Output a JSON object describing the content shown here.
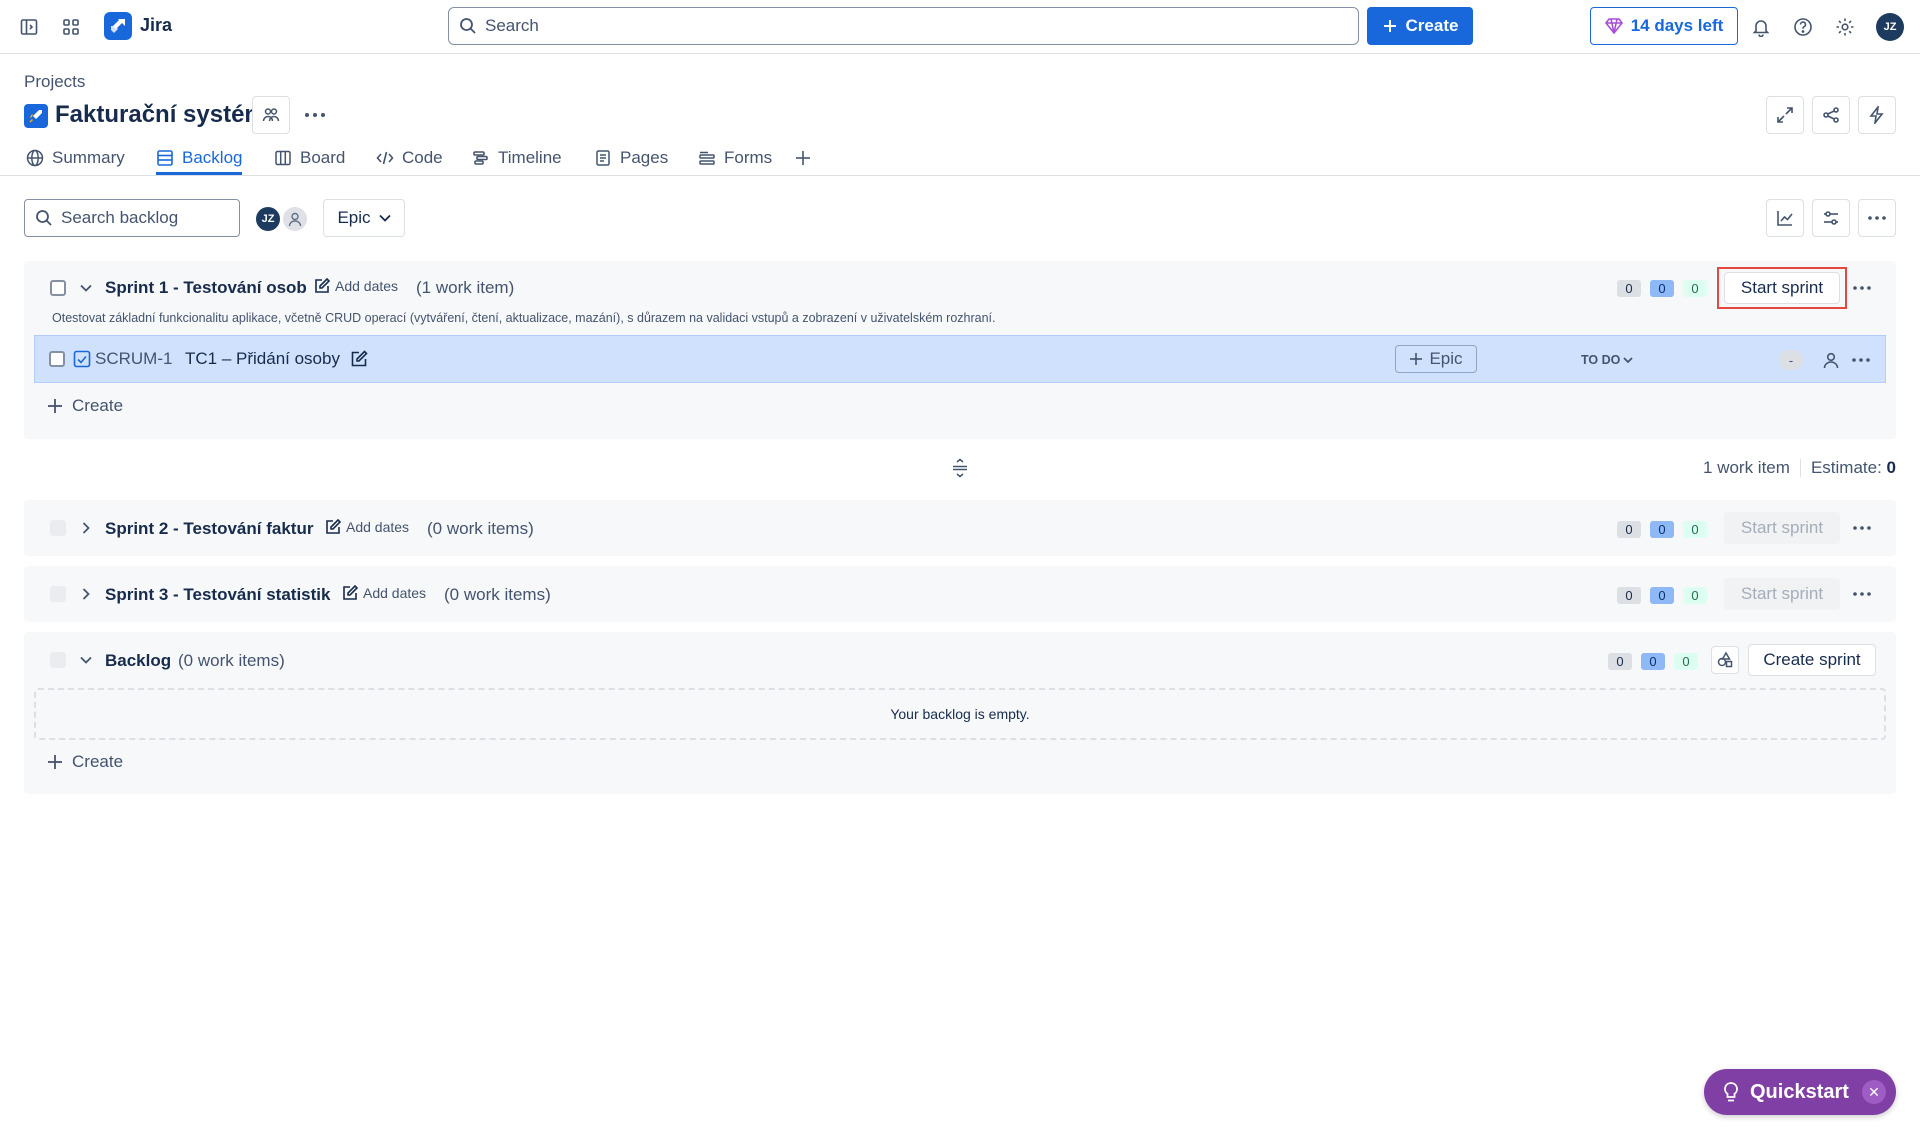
{
  "topbar": {
    "app_name": "Jira",
    "search_placeholder": "Search",
    "create_label": "Create",
    "trial_label": "14 days left",
    "avatar_initials": "JZ"
  },
  "project": {
    "breadcrumb": "Projects",
    "title": "Fakturační systém"
  },
  "tabs": [
    {
      "label": "Summary",
      "icon": "globe-icon"
    },
    {
      "label": "Backlog",
      "icon": "backlog-icon",
      "active": true
    },
    {
      "label": "Board",
      "icon": "board-icon"
    },
    {
      "label": "Code",
      "icon": "code-icon"
    },
    {
      "label": "Timeline",
      "icon": "timeline-icon"
    },
    {
      "label": "Pages",
      "icon": "pages-icon"
    },
    {
      "label": "Forms",
      "icon": "forms-icon"
    }
  ],
  "toolbar": {
    "search_placeholder": "Search backlog",
    "avatar_initials": "JZ",
    "epic_filter_label": "Epic"
  },
  "sprints": [
    {
      "name": "Sprint 1 - Testování osob",
      "add_dates": "Add dates",
      "count": "(1 work item)",
      "todo": "0",
      "in_progress": "0",
      "done": "0",
      "action": "Start sprint",
      "description": "Otestovat základní funkcionalitu aplikace, včetně CRUD operací (vytváření, čtení, aktualizace, mazání), s důrazem na validaci vstupů a zobrazení v uživatelském rozhraní.",
      "issue": {
        "key": "SCRUM-1",
        "title": "TC1 – Přidání osoby",
        "epic_label": "Epic",
        "status": "TO DO",
        "estimate": "-"
      },
      "create_label": "Create"
    },
    {
      "name": "Sprint 2 - Testování faktur",
      "add_dates": "Add dates",
      "count": "(0 work items)",
      "todo": "0",
      "in_progress": "0",
      "done": "0",
      "action": "Start sprint"
    },
    {
      "name": "Sprint 3 - Testování statistik",
      "add_dates": "Add dates",
      "count": "(0 work items)",
      "todo": "0",
      "in_progress": "0",
      "done": "0",
      "action": "Start sprint"
    }
  ],
  "summary": {
    "work_items": "1 work item",
    "estimate_label": "Estimate:",
    "estimate_value": "0"
  },
  "backlog": {
    "name": "Backlog",
    "count": "(0 work items)",
    "todo": "0",
    "in_progress": "0",
    "done": "0",
    "action": "Create sprint",
    "empty_message": "Your backlog is empty.",
    "create_label": "Create"
  },
  "quickstart": {
    "label": "Quickstart"
  },
  "colors": {
    "brand_blue": "#1868db",
    "highlight_red": "#e2483d",
    "quickstart_purple": "#803fa5"
  }
}
